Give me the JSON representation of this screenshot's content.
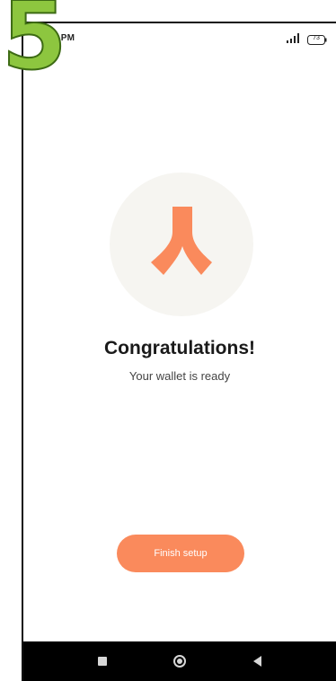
{
  "overlay": {
    "step_number": "5"
  },
  "status_bar": {
    "time": "3:39 PM",
    "battery": "73"
  },
  "congrats": {
    "title": "Congratulations!",
    "subtitle": "Your wallet is ready"
  },
  "actions": {
    "finish_label": "Finish setup"
  },
  "colors": {
    "accent": "#fa8a5c",
    "logo_bg": "#f6f5f1",
    "step_green": "#8dc63f"
  },
  "icons": {
    "logo": "wallet-logo-icon",
    "signal": "signal-icon",
    "battery": "battery-icon",
    "nav_recent": "square-icon",
    "nav_home": "circle-icon",
    "nav_back": "triangle-back-icon"
  }
}
